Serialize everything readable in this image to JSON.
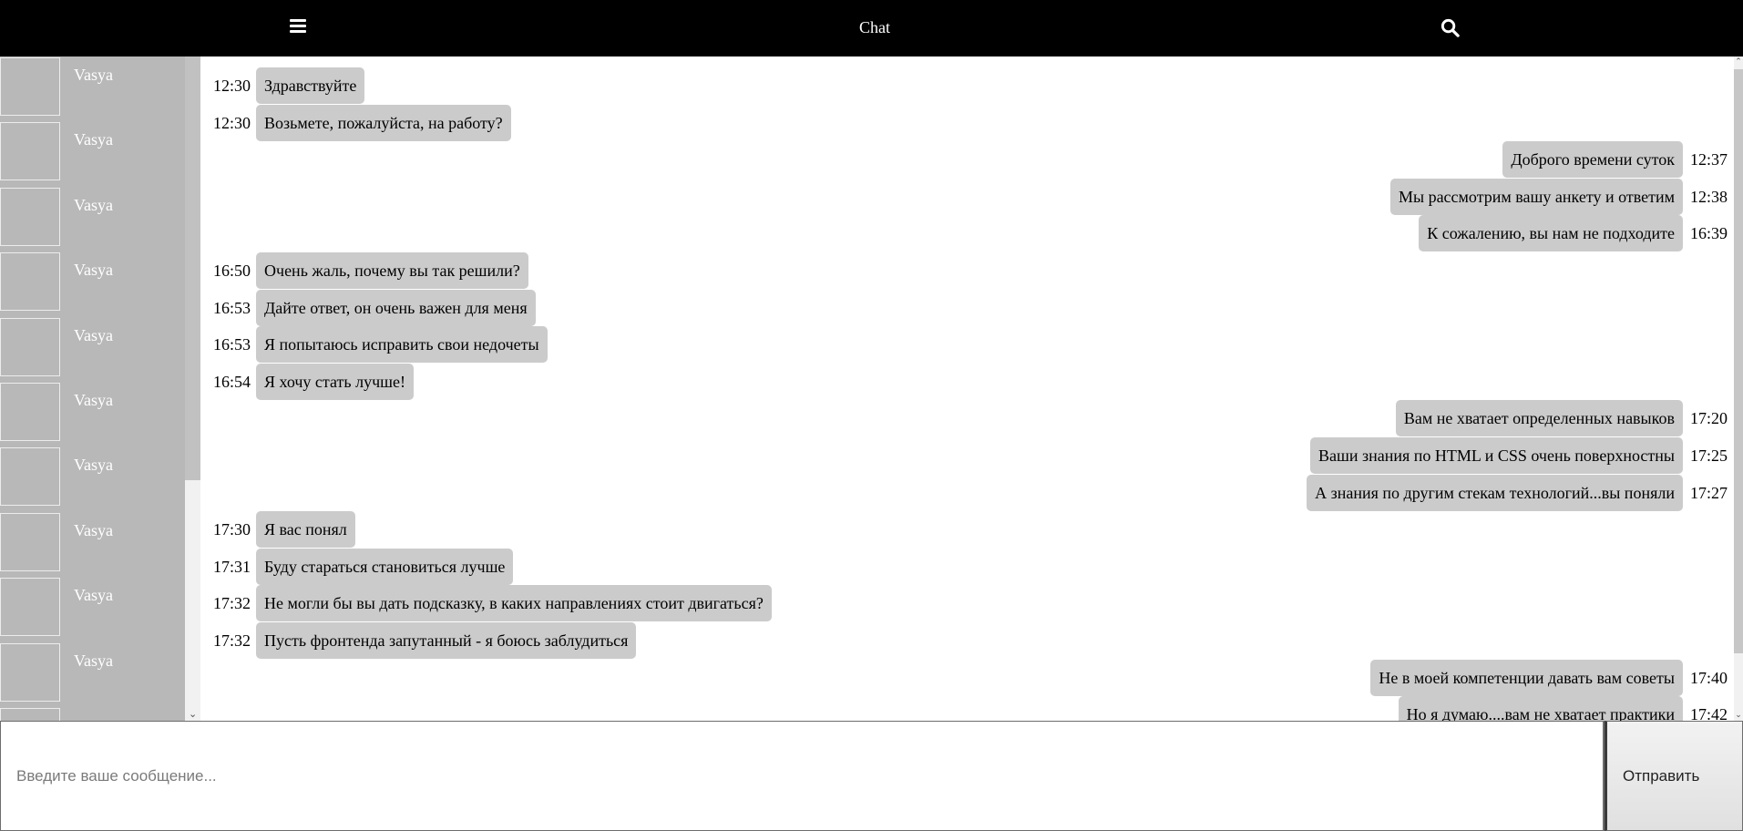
{
  "header": {
    "title": "Chat",
    "menu_icon": "hamburger-menu-icon",
    "search_icon": "search-icon"
  },
  "sidebar": {
    "contacts": [
      {
        "name": "Vasya"
      },
      {
        "name": "Vasya"
      },
      {
        "name": "Vasya"
      },
      {
        "name": "Vasya"
      },
      {
        "name": "Vasya"
      },
      {
        "name": "Vasya"
      },
      {
        "name": "Vasya"
      },
      {
        "name": "Vasya"
      },
      {
        "name": "Vasya"
      },
      {
        "name": "Vasya"
      },
      {
        "name": ""
      }
    ]
  },
  "messages": [
    {
      "side": "left",
      "time": "12:30",
      "text": "Здравствуйте"
    },
    {
      "side": "left",
      "time": "12:30",
      "text": "Возьмете, пожалуйста, на работу?"
    },
    {
      "side": "right",
      "time": "12:37",
      "text": "Доброго времени суток"
    },
    {
      "side": "right",
      "time": "12:38",
      "text": "Мы рассмотрим вашу анкету и ответим"
    },
    {
      "side": "right",
      "time": "16:39",
      "text": "К сожалению, вы нам не подходите"
    },
    {
      "side": "left",
      "time": "16:50",
      "text": "Очень жаль, почему вы так решили?"
    },
    {
      "side": "left",
      "time": "16:53",
      "text": "Дайте ответ, он очень важен для меня"
    },
    {
      "side": "left",
      "time": "16:53",
      "text": "Я попытаюсь исправить свои недочеты"
    },
    {
      "side": "left",
      "time": "16:54",
      "text": "Я хочу стать лучше!"
    },
    {
      "side": "right",
      "time": "17:20",
      "text": "Вам не хватает определенных навыков"
    },
    {
      "side": "right",
      "time": "17:25",
      "text": "Ваши знания по HTML и CSS очень поверхностны"
    },
    {
      "side": "right",
      "time": "17:27",
      "text": "А знания по другим стекам технологий...вы поняли"
    },
    {
      "side": "left",
      "time": "17:30",
      "text": "Я вас понял"
    },
    {
      "side": "left",
      "time": "17:31",
      "text": "Буду стараться становиться лучше"
    },
    {
      "side": "left",
      "time": "17:32",
      "text": "Не могли бы вы дать подсказку, в каких направлениях стоит двигаться?"
    },
    {
      "side": "left",
      "time": "17:32",
      "text": "Пусть фронтенда запутанный - я боюсь заблудиться"
    },
    {
      "side": "right",
      "time": "17:40",
      "text": "Не в моей компетенции давать вам советы"
    },
    {
      "side": "right",
      "time": "17:42",
      "text": "Но я думаю....вам не хватает практики"
    }
  ],
  "composer": {
    "value": "",
    "placeholder": "Введите ваше сообщение...",
    "send_label": "Отправить"
  }
}
